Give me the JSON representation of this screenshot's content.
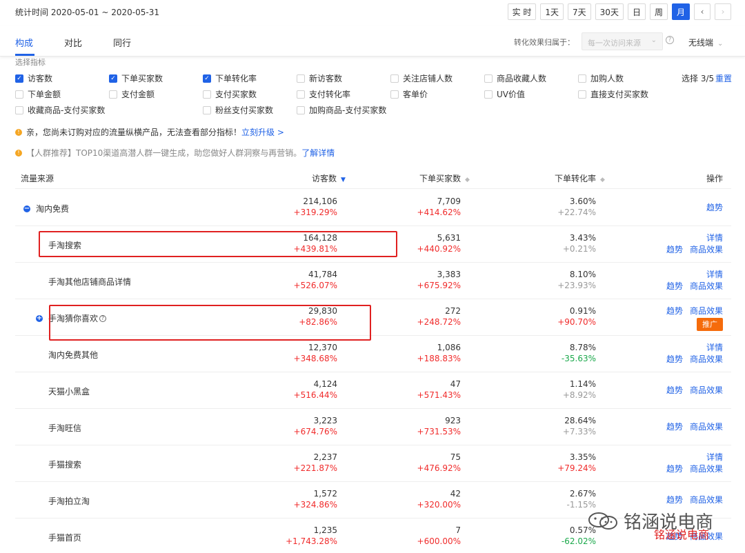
{
  "header": {
    "stat_time": "统计时间 2020-05-01 ~ 2020-05-31",
    "ranges": [
      "实 时",
      "1天",
      "7天",
      "30天",
      "日",
      "周",
      "月"
    ],
    "active_range": "月"
  },
  "tabs": {
    "items": [
      "构成",
      "对比",
      "同行"
    ],
    "active": "构成",
    "attr_label": "转化效果归属于：",
    "attr_select": "每一次访问来源",
    "device": "无线端"
  },
  "metrics": {
    "title": "选择指标",
    "items": [
      {
        "label": "访客数",
        "checked": true
      },
      {
        "label": "下单买家数",
        "checked": true
      },
      {
        "label": "下单转化率",
        "checked": true
      },
      {
        "label": "新访客数",
        "checked": false
      },
      {
        "label": "关注店铺人数",
        "checked": false
      },
      {
        "label": "商品收藏人数",
        "checked": false
      },
      {
        "label": "加购人数",
        "checked": false
      },
      {
        "label": "下单金额",
        "checked": false
      },
      {
        "label": "支付金额",
        "checked": false
      },
      {
        "label": "支付买家数",
        "checked": false
      },
      {
        "label": "支付转化率",
        "checked": false
      },
      {
        "label": "客单价",
        "checked": false
      },
      {
        "label": "UV价值",
        "checked": false
      },
      {
        "label": "直接支付买家数",
        "checked": false
      },
      {
        "label": "收藏商品-支付买家数",
        "checked": false
      },
      {
        "label": "粉丝支付买家数",
        "checked": false
      },
      {
        "label": "加购商品-支付买家数",
        "checked": false
      }
    ],
    "select_count": "选择 3/5",
    "reset": "重置"
  },
  "notices": {
    "n1_text": "亲，您尚未订购对应的流量纵横产品，无法查看部分指标！",
    "n1_link": "立刻升级 >",
    "n2_text": "【人群推荐】TOP10渠道高潜人群一键生成，助您做好人群洞察与再营销。",
    "n2_link": "了解详情"
  },
  "table": {
    "headers": {
      "source": "流量来源",
      "visitors": "访客数",
      "buyers": "下单买家数",
      "rate": "下单转化率",
      "ops": "操作"
    },
    "rows": [
      {
        "source": "淘内免费",
        "v": "214,106",
        "vc": "+319.29%",
        "b": "7,709",
        "bc": "+414.62%",
        "r": "3.60%",
        "rc": "+22.74%"
      },
      {
        "source": "手淘搜索",
        "v": "164,128",
        "vc": "+439.81%",
        "b": "5,631",
        "bc": "+440.92%",
        "r": "3.43%",
        "rc": "+0.21%"
      },
      {
        "source": "手淘其他店铺商品详情",
        "v": "41,784",
        "vc": "+526.07%",
        "b": "3,383",
        "bc": "+675.92%",
        "r": "8.10%",
        "rc": "+23.93%"
      },
      {
        "source": "手淘猜你喜欢",
        "v": "29,830",
        "vc": "+82.86%",
        "b": "272",
        "bc": "+248.72%",
        "r": "0.91%",
        "rc": "+90.70%"
      },
      {
        "source": "淘内免费其他",
        "v": "12,370",
        "vc": "+348.68%",
        "b": "1,086",
        "bc": "+188.83%",
        "r": "8.78%",
        "rc": "-35.63%"
      },
      {
        "source": "天猫小黑盒",
        "v": "4,124",
        "vc": "+516.44%",
        "b": "47",
        "bc": "+571.43%",
        "r": "1.14%",
        "rc": "+8.92%"
      },
      {
        "source": "手淘旺信",
        "v": "3,223",
        "vc": "+674.76%",
        "b": "923",
        "bc": "+731.53%",
        "r": "28.64%",
        "rc": "+7.33%"
      },
      {
        "source": "手猫搜索",
        "v": "2,237",
        "vc": "+221.87%",
        "b": "75",
        "bc": "+476.92%",
        "r": "3.35%",
        "rc": "+79.24%"
      },
      {
        "source": "手淘拍立淘",
        "v": "1,572",
        "vc": "+324.86%",
        "b": "42",
        "bc": "+320.00%",
        "r": "2.67%",
        "rc": "-1.15%"
      },
      {
        "source": "手猫首页",
        "v": "1,235",
        "vc": "+1,743.28%",
        "b": "7",
        "bc": "+600.00%",
        "r": "0.57%",
        "rc": "-62.02%"
      }
    ],
    "op_labels": {
      "detail": "详情",
      "trend": "趋势",
      "goods": "商品效果",
      "promo": "推广"
    }
  },
  "watermark": {
    "text": "铭涵说电商",
    "red_text": "铭涵说电商"
  },
  "colors": {
    "accent": "#2062e6",
    "up": "#f02b2b",
    "down": "#1aa84a",
    "promo": "#f56b0b",
    "highlight": "#e02020"
  }
}
